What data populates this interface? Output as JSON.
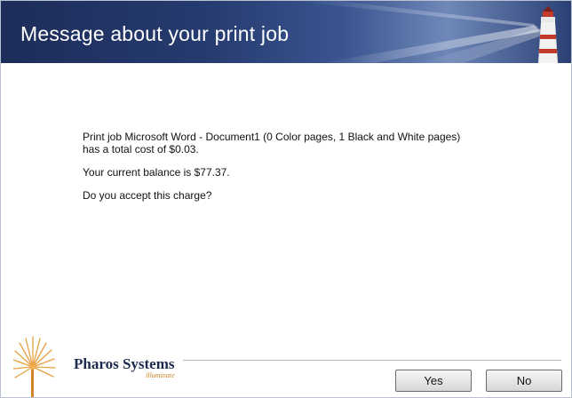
{
  "window": {
    "title": "Message about your print job"
  },
  "message": {
    "line1": "Print job Microsoft Word - Document1 (0 Color pages, 1 Black and White pages)",
    "line2": "has a total cost of $0.03.",
    "balance": "Your current balance is $77.37.",
    "question": "Do you accept this charge?"
  },
  "branding": {
    "company": "Pharos Systems",
    "product": "illuminate",
    "icon": "sunburst-logo-icon",
    "banner_icon": "lighthouse-icon"
  },
  "buttons": {
    "yes_label": "Yes",
    "no_label": "No"
  },
  "colors": {
    "banner": "#253a6e",
    "brand_text": "#1b2a4d",
    "brand_accent": "#d4832a"
  }
}
